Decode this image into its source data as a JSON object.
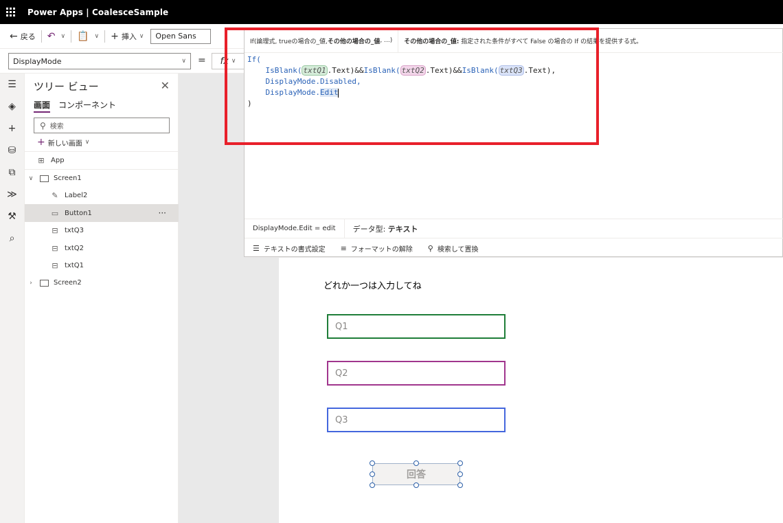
{
  "topbar": {
    "app_name": "Power Apps",
    "separator": "|",
    "file_name": "CoalesceSample"
  },
  "commandbar": {
    "back_label": "戻る",
    "insert_label": "挿入",
    "font_value": "Open Sans"
  },
  "formula_bar": {
    "property": "DisplayMode",
    "equals": "=",
    "fx_label": "fx"
  },
  "formula_panel": {
    "signature_prefix": "If(論理式, trueの場合の_値, ",
    "signature_bold": "その他の場合の_値",
    "signature_suffix": ", ...)",
    "desc_bold": "その他の場合の_値:",
    "desc_text": " 指定された条件がすべて False の場合の If の結果を提供する式。",
    "code": {
      "if_open": "If(",
      "isblank": "IsBlank(",
      "txtq1": "txtQ1",
      "txtq2": "txtQ2",
      "txtq3": "txtQ3",
      "dot_text_and": ".Text)&&",
      "dot_text_close": ".Text),",
      "displaymode_disabled": "DisplayMode.Disabled,",
      "displaymode_prefix": "DisplayMode.",
      "edit": "Edit",
      "close": ")"
    },
    "result_value": "DisplayMode.Edit  =  edit",
    "data_type_label": "データ型: ",
    "data_type_value": "テキスト",
    "tools": {
      "format_text": "テキストの書式設定",
      "remove_format": "フォーマットの解除",
      "find_replace": "検索して置換"
    }
  },
  "tree_view": {
    "title": "ツリー ビュー",
    "tabs": [
      "画面",
      "コンポーネント"
    ],
    "search_placeholder": "検索",
    "new_screen_label": "新しい画面",
    "items": {
      "app": "App",
      "screen1": "Screen1",
      "label2": "Label2",
      "button1": "Button1",
      "txtq3": "txtQ3",
      "txtq2": "txtQ2",
      "txtq1": "txtQ1",
      "screen2": "Screen2"
    }
  },
  "canvas": {
    "label_text": "どれか一つは入力してね",
    "q1_placeholder": "Q1",
    "q2_placeholder": "Q2",
    "q3_placeholder": "Q3",
    "button_label": "回答"
  },
  "colors": {
    "q1_border": "#1e7d38",
    "q2_border": "#a0358d",
    "q3_border": "#4466dd",
    "highlight_frame": "#e8202a",
    "accent": "#742774"
  }
}
